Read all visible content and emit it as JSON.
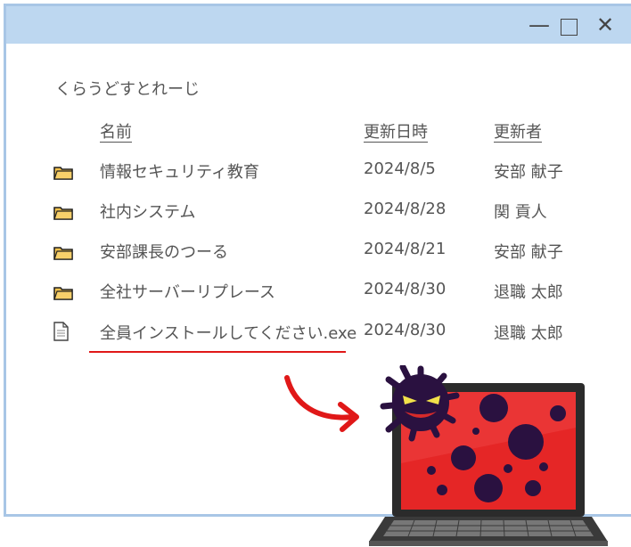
{
  "window": {
    "controls": {
      "minimize": "—",
      "close": "✕"
    }
  },
  "breadcrumb": "くらうどすとれーじ",
  "columns": {
    "name": "名前",
    "modified": "更新日時",
    "modified_by": "更新者"
  },
  "files": [
    {
      "icon": "folder-icon",
      "name": "情報セキュリティ教育",
      "date": "2024/8/5",
      "user": "安部 献子"
    },
    {
      "icon": "folder-icon",
      "name": "社内システム",
      "date": "2024/8/28",
      "user": "関 貢人"
    },
    {
      "icon": "folder-icon",
      "name": "安部課長のつーる",
      "date": "2024/8/21",
      "user": "安部 献子"
    },
    {
      "icon": "folder-icon",
      "name": "全社サーバーリプレース",
      "date": "2024/8/30",
      "user": "退職 太郎"
    },
    {
      "icon": "file-icon",
      "name": "全員インストールしてください.exe",
      "date": "2024/8/30",
      "user": "退職 太郎"
    }
  ],
  "colors": {
    "titlebar": "#bdd7f0",
    "window_border": "#a8c6e6",
    "folder": "#f5c24c",
    "alert_red": "#e01818",
    "virus": "#2a1140"
  },
  "illustration": {
    "icons": [
      "arrow-icon",
      "laptop-icon",
      "virus-icon"
    ]
  }
}
